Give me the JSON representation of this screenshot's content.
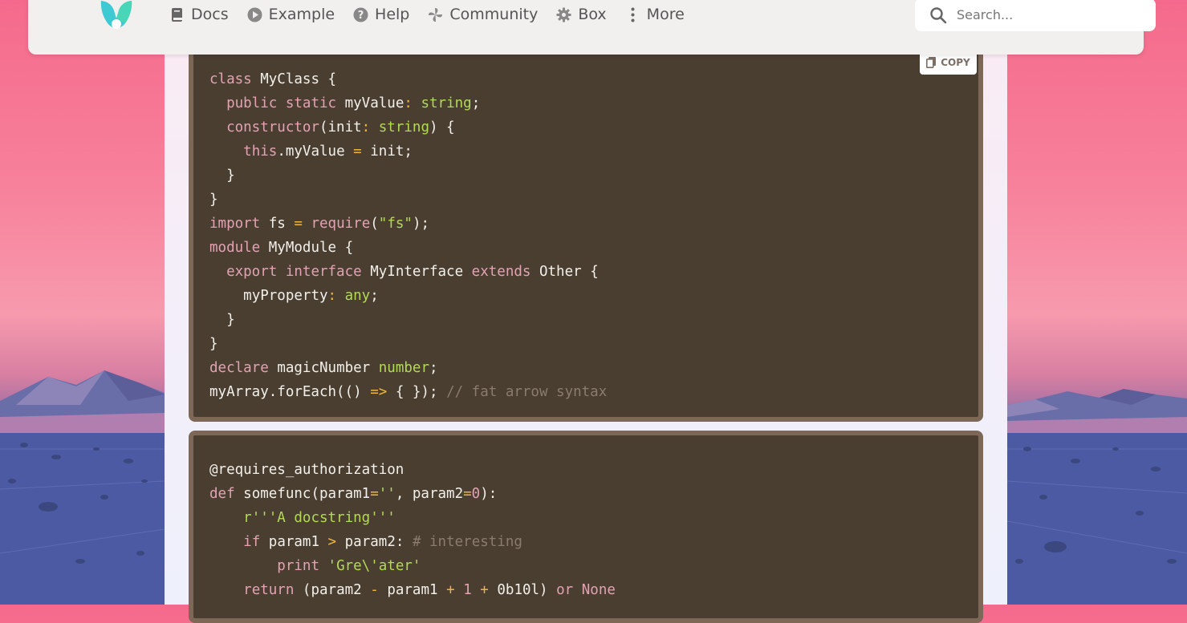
{
  "nav": {
    "items": [
      {
        "label": "Docs",
        "icon": "book-icon"
      },
      {
        "label": "Example",
        "icon": "play-circle-icon"
      },
      {
        "label": "Help",
        "icon": "help-circle-icon"
      },
      {
        "label": "Community",
        "icon": "community-icon"
      },
      {
        "label": "Box",
        "icon": "gear-icon"
      },
      {
        "label": "More",
        "icon": "more-vertical-icon"
      }
    ],
    "search": {
      "placeholder": "Search...",
      "value": ""
    }
  },
  "copy_button": {
    "label": "COPY",
    "icon": "copy-icon"
  },
  "code_blocks": [
    {
      "language": "typescript",
      "lines": [
        "class MyClass {",
        "  public static myValue: string;",
        "  constructor(init: string) {",
        "    this.myValue = init;",
        "  }",
        "}",
        "import fs = require(\"fs\");",
        "module MyModule {",
        "  export interface MyInterface extends Other {",
        "    myProperty: any;",
        "  }",
        "}",
        "declare magicNumber number;",
        "myArray.forEach(() => { }); // fat arrow syntax"
      ]
    },
    {
      "language": "python",
      "lines": [
        "@requires_authorization",
        "def somefunc(param1='', param2=0):",
        "    r'''A docstring'''",
        "    if param1 > param2: # interesting",
        "        print 'Gre\\'ater'",
        "    return (param2 - param1 + 1 + 0b10l) or None"
      ]
    }
  ],
  "colors": {
    "code_bg": "#4a3e31",
    "code_border": "#7d6757",
    "keyword": "#e3a2b4",
    "type": "#b2d957",
    "operator": "#f0b53b",
    "comment": "#8a7c6d",
    "logo_teal": "#3ec9d3"
  }
}
